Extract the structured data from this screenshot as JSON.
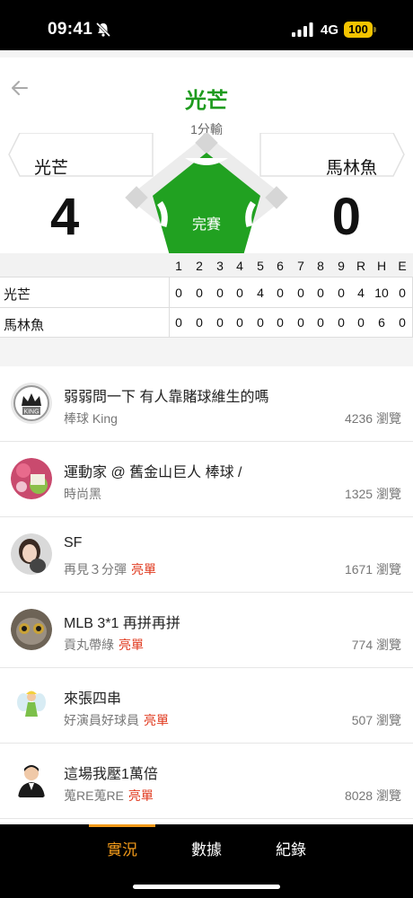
{
  "status_bar": {
    "time": "09:41",
    "network": "4G",
    "battery": "100"
  },
  "header": {
    "title": "光芒",
    "subtitle": "1分輸"
  },
  "teams": {
    "away": {
      "name": "光芒",
      "score": "4"
    },
    "home": {
      "name": "馬林魚",
      "score": "0"
    }
  },
  "game_status": "完賽",
  "box_score": {
    "columns": [
      "1",
      "2",
      "3",
      "4",
      "5",
      "6",
      "7",
      "8",
      "9",
      "R",
      "H",
      "E"
    ],
    "rows": [
      {
        "team": "光芒",
        "values": [
          "0",
          "0",
          "0",
          "0",
          "4",
          "0",
          "0",
          "0",
          "0",
          "4",
          "10",
          "0"
        ]
      },
      {
        "team": "馬林魚",
        "values": [
          "0",
          "0",
          "0",
          "0",
          "0",
          "0",
          "0",
          "0",
          "0",
          "0",
          "6",
          "0"
        ]
      }
    ]
  },
  "posts": [
    {
      "title": "弱弱問一下 有人靠賭球維生的嗎",
      "author": "棒球 King",
      "badge": "",
      "views": "4236 瀏覽",
      "avatar_icon": "crown-king-avatar"
    },
    {
      "title": "運動家 @ 舊金山巨人 棒球 /",
      "author": "時尚黑",
      "badge": "",
      "views": "1325 瀏覽",
      "avatar_icon": "fruit-photo-avatar"
    },
    {
      "title": "SF",
      "author": "再見３分彈",
      "badge": "亮單",
      "views": "1671 瀏覽",
      "avatar_icon": "woman-photo-avatar"
    },
    {
      "title": "MLB 3*1 再拼再拼",
      "author": "貢丸帶綠",
      "badge": "亮單",
      "views": "774 瀏覽",
      "avatar_icon": "lemur-photo-avatar"
    },
    {
      "title": "來張四串",
      "author": "好演員好球員",
      "badge": "亮單",
      "views": "507 瀏覽",
      "avatar_icon": "fairy-avatar"
    },
    {
      "title": "這場我壓1萬倍",
      "author": "蒐RE蒐RE",
      "badge": "亮單",
      "views": "8028 瀏覽",
      "avatar_icon": "man-tuxedo-avatar"
    }
  ],
  "tabs": [
    {
      "label": "實況",
      "active": true
    },
    {
      "label": "數據",
      "active": false
    },
    {
      "label": "紀錄",
      "active": false
    }
  ],
  "colors": {
    "accent_green": "#1e9b1e",
    "tab_active": "#f29a1a",
    "badge_red": "#e0391e"
  }
}
